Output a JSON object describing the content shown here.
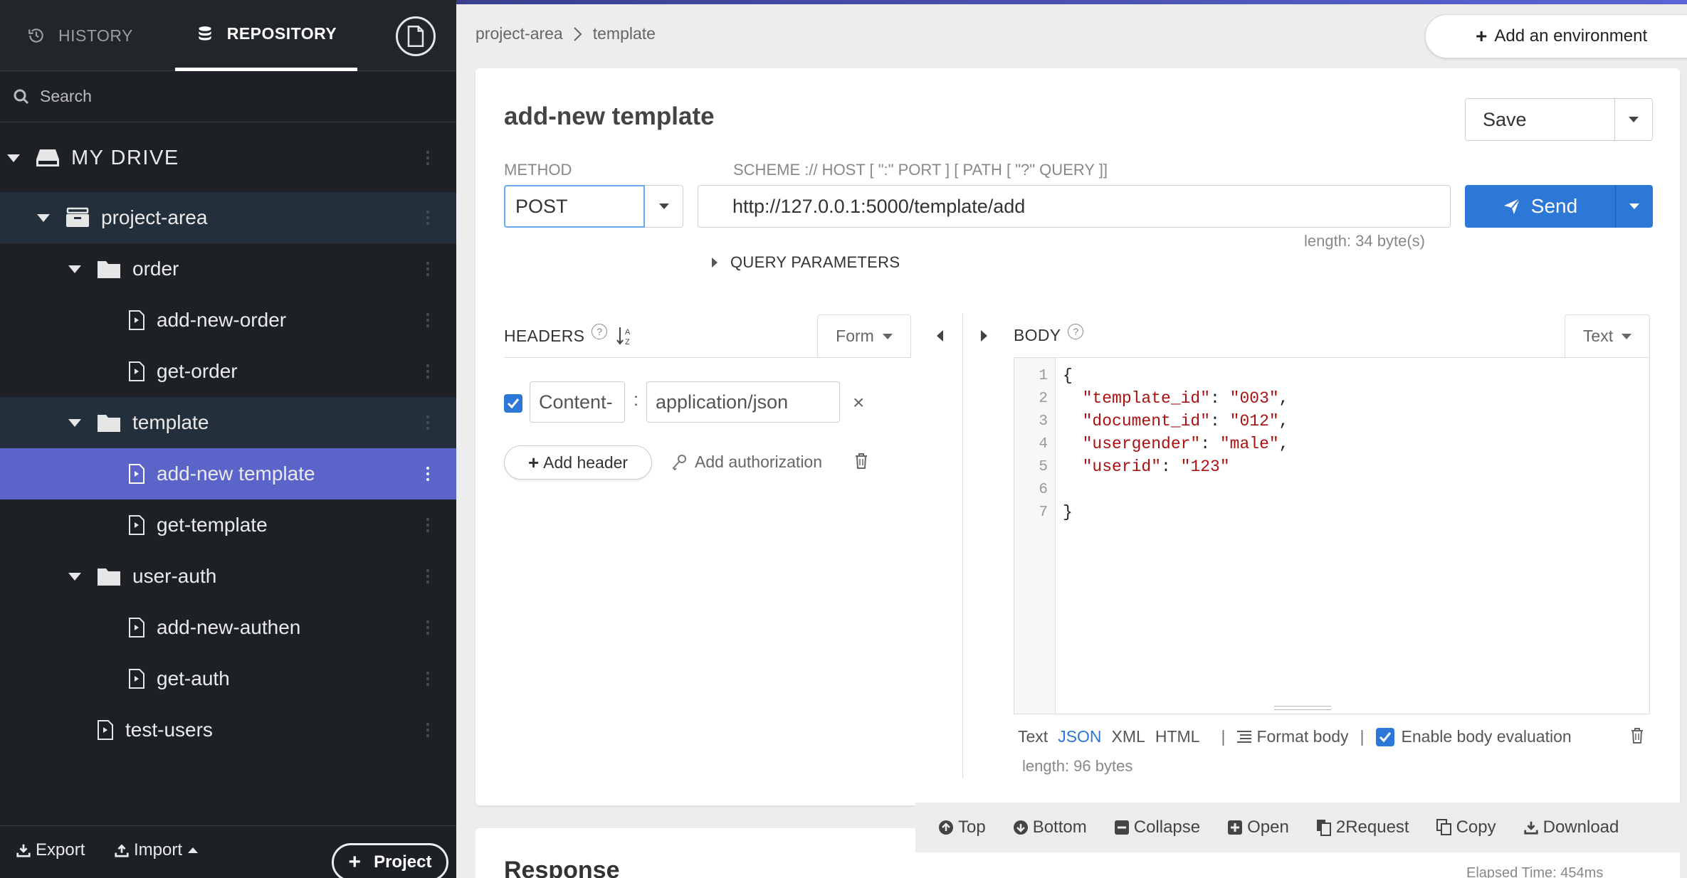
{
  "sidebar": {
    "tabs": {
      "history": "HISTORY",
      "repository": "REPOSITORY"
    },
    "search_placeholder": "Search",
    "tree": {
      "root": "MY DRIVE",
      "project": "project-area",
      "order": "order",
      "add_new_order": "add-new-order",
      "get_order": "get-order",
      "template": "template",
      "add_new_template": "add-new template",
      "get_template": "get-template",
      "user_auth": "user-auth",
      "add_new_authen": "add-new-authen",
      "get_auth": "get-auth",
      "test_users": "test-users"
    },
    "footer": {
      "export": "Export",
      "import": "Import",
      "project": "Project"
    }
  },
  "breadcrumb": {
    "project": "project-area",
    "folder": "template"
  },
  "env_button": "Add an environment",
  "request": {
    "title": "add-new template",
    "save_label": "Save",
    "method_label": "METHOD",
    "method": "POST",
    "url_label": "SCHEME :// HOST [ \":\" PORT ] [ PATH [ \"?\" QUERY ]]",
    "url": "http://127.0.0.1:5000/template/add",
    "url_length": "length: 34 byte(s)",
    "send_label": "Send",
    "query_params": "QUERY PARAMETERS"
  },
  "headers": {
    "title": "HEADERS",
    "mode": "Form",
    "rows": [
      {
        "name": "Content-",
        "value": "application/json",
        "enabled": true
      }
    ],
    "add_header": "Add header",
    "add_auth": "Add authorization"
  },
  "body": {
    "title": "BODY",
    "mode": "Text",
    "line_numbers": [
      "1",
      "2",
      "3",
      "4",
      "5",
      "6",
      "7"
    ],
    "code": {
      "l1": "{",
      "l2_key": "\"template_id\"",
      "l2_val": "\"003\"",
      "l3_key": "\"document_id\"",
      "l3_val": "\"012\"",
      "l4_key": "\"usergender\"",
      "l4_val": "\"male\"",
      "l5_key": "\"userid\"",
      "l5_val": "\"123\"",
      "l7": "}"
    },
    "formats": {
      "text": "Text",
      "json": "JSON",
      "xml": "XML",
      "html": "HTML"
    },
    "format_body": "Format body",
    "enable_eval": "Enable body evaluation",
    "length": "length: 96 bytes"
  },
  "toolbar": {
    "top": "Top",
    "bottom": "Bottom",
    "collapse": "Collapse",
    "open": "Open",
    "to_request": "2Request",
    "copy": "Copy",
    "download": "Download"
  },
  "response": {
    "title": "Response",
    "elapsed": "Elapsed Time: 454ms"
  },
  "colors": {
    "accent": "#2d77d6",
    "active_row": "#5b64c9",
    "sidebar_bg": "#1d2024",
    "json_string": "#aa1111"
  }
}
